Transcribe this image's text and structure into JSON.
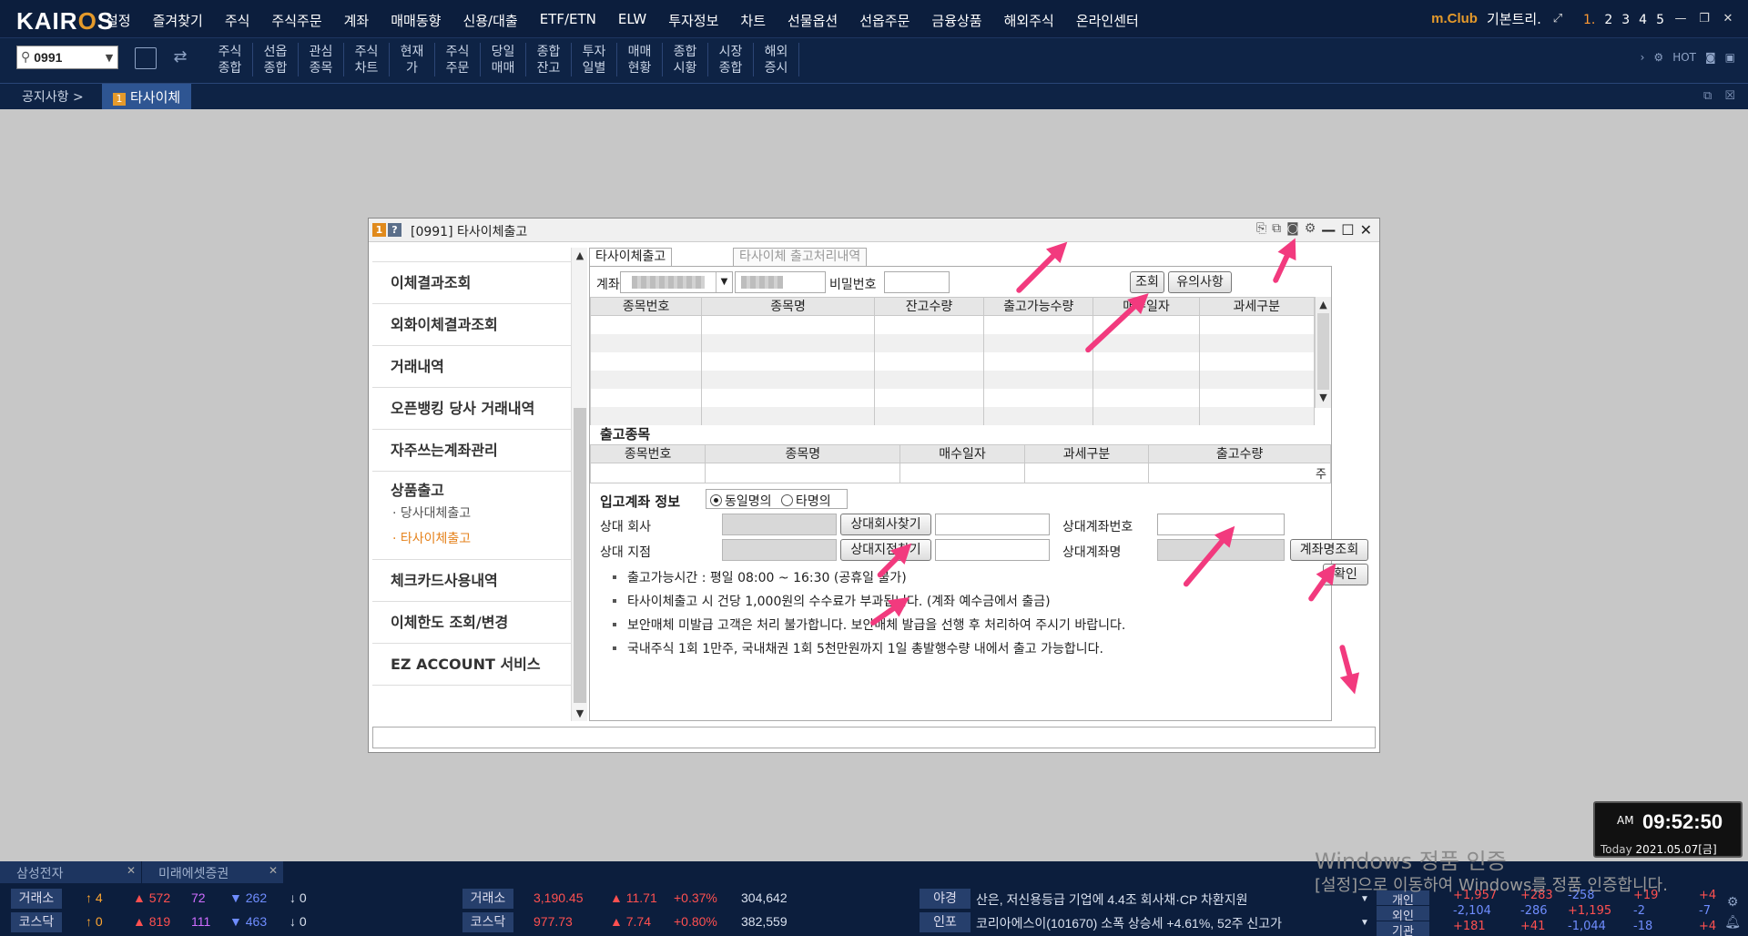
{
  "app": {
    "logo": "KAIROS",
    "menu": [
      "설정",
      "즐겨찾기",
      "주식",
      "주식주문",
      "계좌",
      "매매동향",
      "신용/대출",
      "ETF/ETN",
      "ELW",
      "투자정보",
      "차트",
      "선물옵션",
      "선옵주문",
      "금융상품",
      "해외주식",
      "온라인센터"
    ],
    "mclub": "m.Club",
    "user": "기본트리.",
    "screens": [
      "1.",
      "2",
      "3",
      "4",
      "5"
    ]
  },
  "toolbar": {
    "code": "0991",
    "buttons": [
      [
        "주식",
        "종합"
      ],
      [
        "선옵",
        "종합"
      ],
      [
        "관심",
        "종목"
      ],
      [
        "주식",
        "차트"
      ],
      [
        "현재",
        "가"
      ],
      [
        "주식",
        "주문"
      ],
      [
        "당일",
        "매매"
      ],
      [
        "종합",
        "잔고"
      ],
      [
        "투자",
        "일별"
      ],
      [
        "매매",
        "현황"
      ],
      [
        "종합",
        "시황"
      ],
      [
        "시장",
        "종합"
      ],
      [
        "해외",
        "증시"
      ]
    ]
  },
  "tabs": {
    "notice": "공지사항 >",
    "active_num": "1",
    "active": "타사이체"
  },
  "window": {
    "title": "[0991] 타사이체출고",
    "nav": {
      "items": [
        "이체결과조회",
        "외화이체결과조회",
        "거래내역",
        "오픈뱅킹 당사 거래내역",
        "자주쓰는계좌관리"
      ],
      "group": "상품출고",
      "subs": [
        "· 당사대체출고",
        "· 타사이체출고"
      ],
      "items2": [
        "체크카드사용내역",
        "이체한도 조회/변경",
        "EZ ACCOUNT 서비스"
      ]
    },
    "tabs": [
      "타사이체출고",
      "타사이체 출고처리내역"
    ],
    "account_label": "계좌",
    "password_label": "비밀번호",
    "btn_query": "조회",
    "btn_notice": "유의사항",
    "grid1_headers": [
      "종목번호",
      "종목명",
      "잔고수량",
      "출고가능수량",
      "매수일자",
      "과세구분"
    ],
    "section_out": "출고종목",
    "grid2_headers": [
      "종목번호",
      "종목명",
      "매수일자",
      "과세구분",
      "출고수량"
    ],
    "grid2_unit": "주",
    "section_in": "입고계좌 정보",
    "radio_same": "동일명의",
    "radio_other": "타명의",
    "lbl_company": "상대 회사",
    "btn_company": "상대회사찾기",
    "lbl_branch": "상대 지점",
    "btn_branch": "상대지점찾기",
    "lbl_acctno": "상대계좌번호",
    "lbl_acctname": "상대계좌명",
    "btn_acctname": "계좌명조회",
    "btn_confirm": "확인",
    "notes": [
      "출고가능시간 : 평일 08:00 ~ 16:30 (공휴일 불가)",
      "타사이체출고 시 건당 1,000원의 수수료가 부과됩니다. (계좌 예수금에서 출금)",
      "보안매체 미발급 고객은 처리 불가합니다. 보안매체 발급을 선행 후 처리하여 주시기 바랍니다.",
      "국내주식 1회 1만주, 국내채권 1회 5천만원까지 1일 총발행수량 내에서 출고 가능합니다."
    ]
  },
  "clock": {
    "ampm": "AM",
    "time": "09:52:50",
    "today": "Today",
    "date": "2021.05.07[금]"
  },
  "watermark": {
    "line1": "Windows 정품 인증",
    "line2": "[설정]으로 이동하여 Windows를 정품 인증합니다."
  },
  "bottom": {
    "tabs": [
      "삼성전자",
      "미래에셋증권"
    ],
    "rows": [
      {
        "label": "거래소",
        "a": "↑ 4",
        "b": "▲ 572",
        "c": "72",
        "d": "▼ 262",
        "e": "↓ 0",
        "idx_label": "거래소",
        "idx": "3,190.45",
        "chg": "▲ 11.71",
        "pct": "+0.37%",
        "vol": "304,642",
        "news_label": "야경",
        "news": "산은, 저신용등급 기업에 4.4조 회사채·CP 차환지원"
      },
      {
        "label": "코스닥",
        "a": "↑ 0",
        "b": "▲ 819",
        "c": "111",
        "d": "▼ 463",
        "e": "↓ 0",
        "idx_label": "코스닥",
        "idx": "977.73",
        "chg": "▲ 7.74",
        "pct": "+0.80%",
        "vol": "382,559",
        "news_label": "인포",
        "news": "코리아에스이(101670) 소폭 상승세 +4.61%, 52주 신고가"
      }
    ],
    "investors": [
      {
        "name": "개인",
        "v": [
          "+1,957",
          "+283",
          "-258",
          "+19",
          "+4"
        ]
      },
      {
        "name": "외인",
        "v": [
          "-2,104",
          "-286",
          "+1,195",
          "-2",
          "-7"
        ]
      },
      {
        "name": "기관",
        "v": [
          "+181",
          "+41",
          "-1,044",
          "-18",
          "+4"
        ]
      }
    ]
  },
  "colors": {
    "accent": "#e59a2b",
    "arrow": "#f23a7e",
    "up": "#ff5050",
    "down": "#6f8dff"
  }
}
